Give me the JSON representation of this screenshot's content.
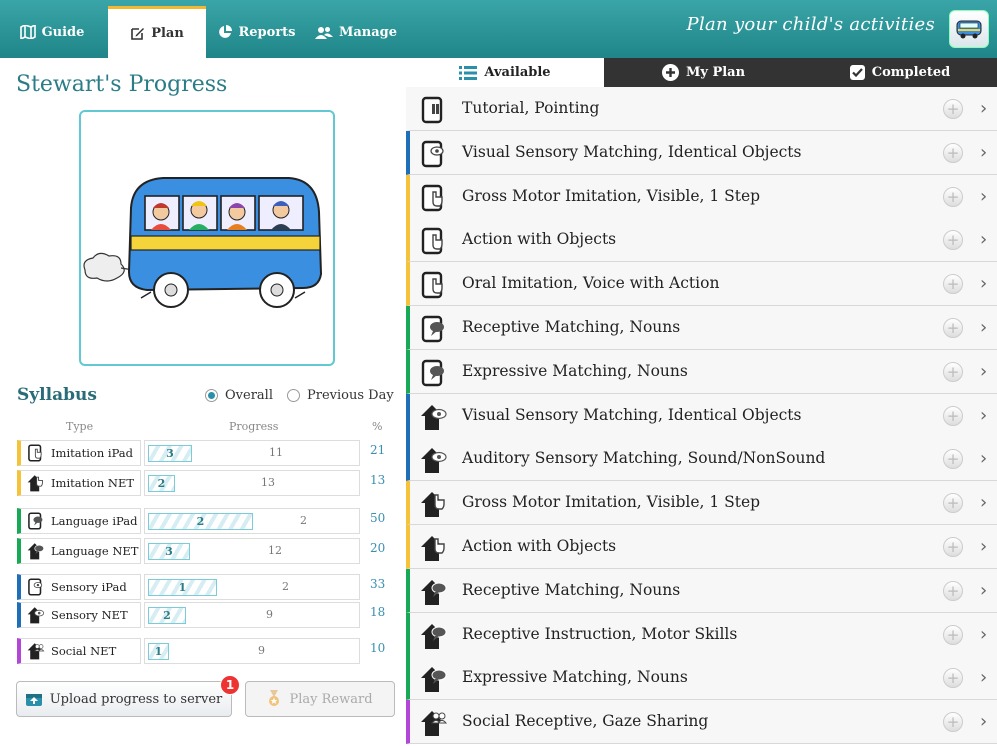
{
  "tabs": [
    {
      "label": "Guide",
      "icon": "map-icon",
      "active": false
    },
    {
      "label": "Plan",
      "icon": "edit-icon",
      "active": true
    },
    {
      "label": "Reports",
      "icon": "pie-chart-icon",
      "active": false
    },
    {
      "label": "Manage",
      "icon": "users-icon",
      "active": false
    }
  ],
  "header": {
    "title": "Plan your child's activities",
    "bus_icon": "bus-icon"
  },
  "left": {
    "student_title": "Stewart's Progress",
    "syllabus_title": "Syllabus",
    "radio_overall": "Overall",
    "radio_previous": "Previous Day",
    "col_type": "Type",
    "col_progress": "Progress",
    "col_pct": "%",
    "rows": [
      {
        "label": "Imitation iPad",
        "done": "3",
        "total": "11",
        "pct": "21",
        "color": "#f5c23a",
        "fraction": 0.21,
        "icon": "tablet-hand-icon"
      },
      {
        "label": "Imitation NET",
        "done": "2",
        "total": "13",
        "pct": "13",
        "color": "#f5c23a",
        "fraction": 0.13,
        "icon": "house-hand-icon"
      },
      {
        "label": "Language iPad",
        "done": "2",
        "total": "2",
        "pct": "50",
        "color": "#18a957",
        "fraction": 0.5,
        "icon": "tablet-speech-icon"
      },
      {
        "label": "Language NET",
        "done": "3",
        "total": "12",
        "pct": "20",
        "color": "#18a957",
        "fraction": 0.2,
        "icon": "house-speech-icon"
      },
      {
        "label": "Sensory iPad",
        "done": "1",
        "total": "2",
        "pct": "33",
        "color": "#1f6fb8",
        "fraction": 0.33,
        "icon": "tablet-eye-icon"
      },
      {
        "label": "Sensory NET",
        "done": "2",
        "total": "9",
        "pct": "18",
        "color": "#1f6fb8",
        "fraction": 0.18,
        "icon": "house-eye-icon"
      },
      {
        "label": "Social NET",
        "done": "1",
        "total": "9",
        "pct": "10",
        "color": "#b346d6",
        "fraction": 0.1,
        "icon": "house-people-icon"
      }
    ],
    "upload_label": "Upload progress to server",
    "upload_badge": "1",
    "reward_label": "Play Reward"
  },
  "subtabs": [
    {
      "label": "Available",
      "icon": "list-icon",
      "active": true
    },
    {
      "label": "My Plan",
      "icon": "plus-circle-icon",
      "active": false
    },
    {
      "label": "Completed",
      "icon": "checkbox-icon",
      "active": false
    }
  ],
  "activities": [
    {
      "name": "Tutorial, Pointing",
      "color": "#f7f7f7",
      "icon": "tablet-tutorial-icon"
    },
    {
      "name": "Visual Sensory Matching, Identical Objects",
      "color": "#1f6fb8",
      "icon": "tablet-eye-icon"
    },
    {
      "name": "Gross Motor Imitation, Visible, 1 Step",
      "color": "#f5c23a",
      "icon": "tablet-hand-icon"
    },
    {
      "name": "Action with Objects",
      "color": "#f5c23a",
      "icon": "tablet-hand-icon"
    },
    {
      "name": "Oral Imitation, Voice with Action",
      "color": "#f5c23a",
      "icon": "tablet-hand-icon"
    },
    {
      "name": "Receptive Matching, Nouns",
      "color": "#18a957",
      "icon": "tablet-speech-icon"
    },
    {
      "name": "Expressive Matching, Nouns",
      "color": "#18a957",
      "icon": "tablet-speech-icon"
    },
    {
      "name": "Visual Sensory Matching, Identical Objects",
      "color": "#1f6fb8",
      "icon": "house-eye-icon"
    },
    {
      "name": "Auditory Sensory Matching, Sound/NonSound",
      "color": "#1f6fb8",
      "icon": "house-eye-icon"
    },
    {
      "name": "Gross Motor Imitation, Visible, 1 Step",
      "color": "#f5c23a",
      "icon": "house-hand-icon"
    },
    {
      "name": "Action with Objects",
      "color": "#f5c23a",
      "icon": "house-hand-icon"
    },
    {
      "name": "Receptive Matching, Nouns",
      "color": "#18a957",
      "icon": "house-speech-icon"
    },
    {
      "name": "Receptive Instruction, Motor Skills",
      "color": "#18a957",
      "icon": "house-speech-icon"
    },
    {
      "name": "Expressive Matching, Nouns",
      "color": "#18a957",
      "icon": "house-speech-icon"
    },
    {
      "name": "Social Receptive, Gaze Sharing",
      "color": "#b346d6",
      "icon": "house-people-icon"
    }
  ]
}
